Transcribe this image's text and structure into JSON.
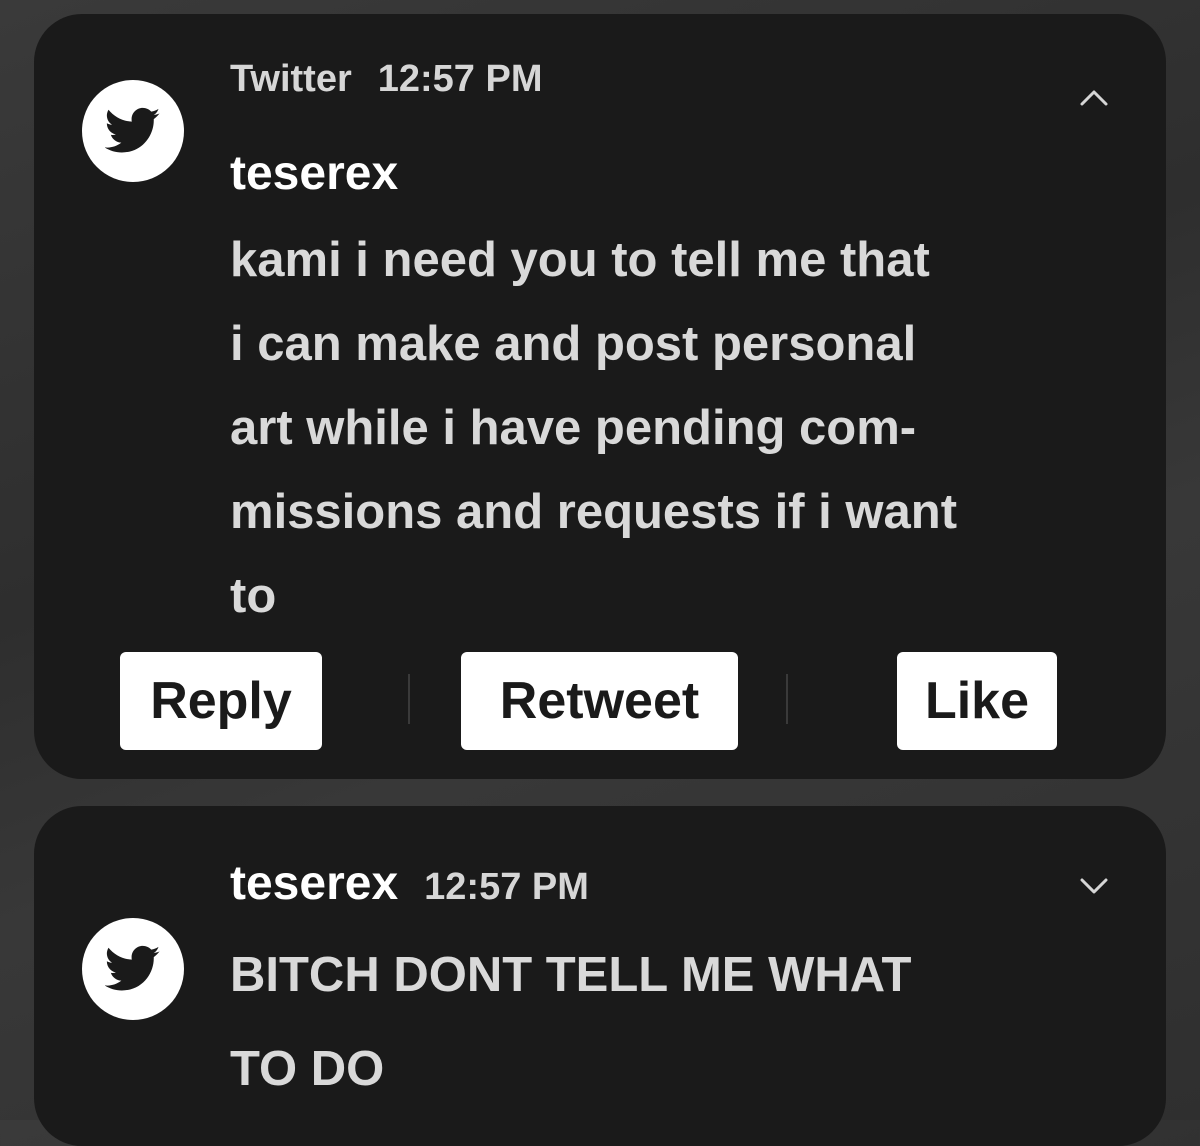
{
  "notifications": [
    {
      "app_icon": "twitter-bird-icon",
      "app_name": "Twitter",
      "time": "12:57 PM",
      "sender": "teserex",
      "chevron": "chevron-up-icon",
      "message_lines": [
        "kami i need you to tell me that",
        "i can make and post personal",
        "art while i have pending com-",
        "missions and requests if i want",
        "to"
      ],
      "actions": {
        "reply": "Reply",
        "retweet": "Retweet",
        "like": "Like"
      }
    },
    {
      "app_icon": "twitter-bird-icon",
      "sender": "teserex",
      "time": "12:57 PM",
      "chevron": "chevron-down-icon",
      "message_lines": [
        "BITCH DONT TELL ME WHAT",
        "TO DO"
      ]
    }
  ],
  "colors": {
    "card_background": "#1a1a1a",
    "icon_circle": "#ffffff",
    "twitter_bird": "#1a1a1a",
    "button_background": "#ffffff",
    "button_text": "#1a1a1a"
  }
}
